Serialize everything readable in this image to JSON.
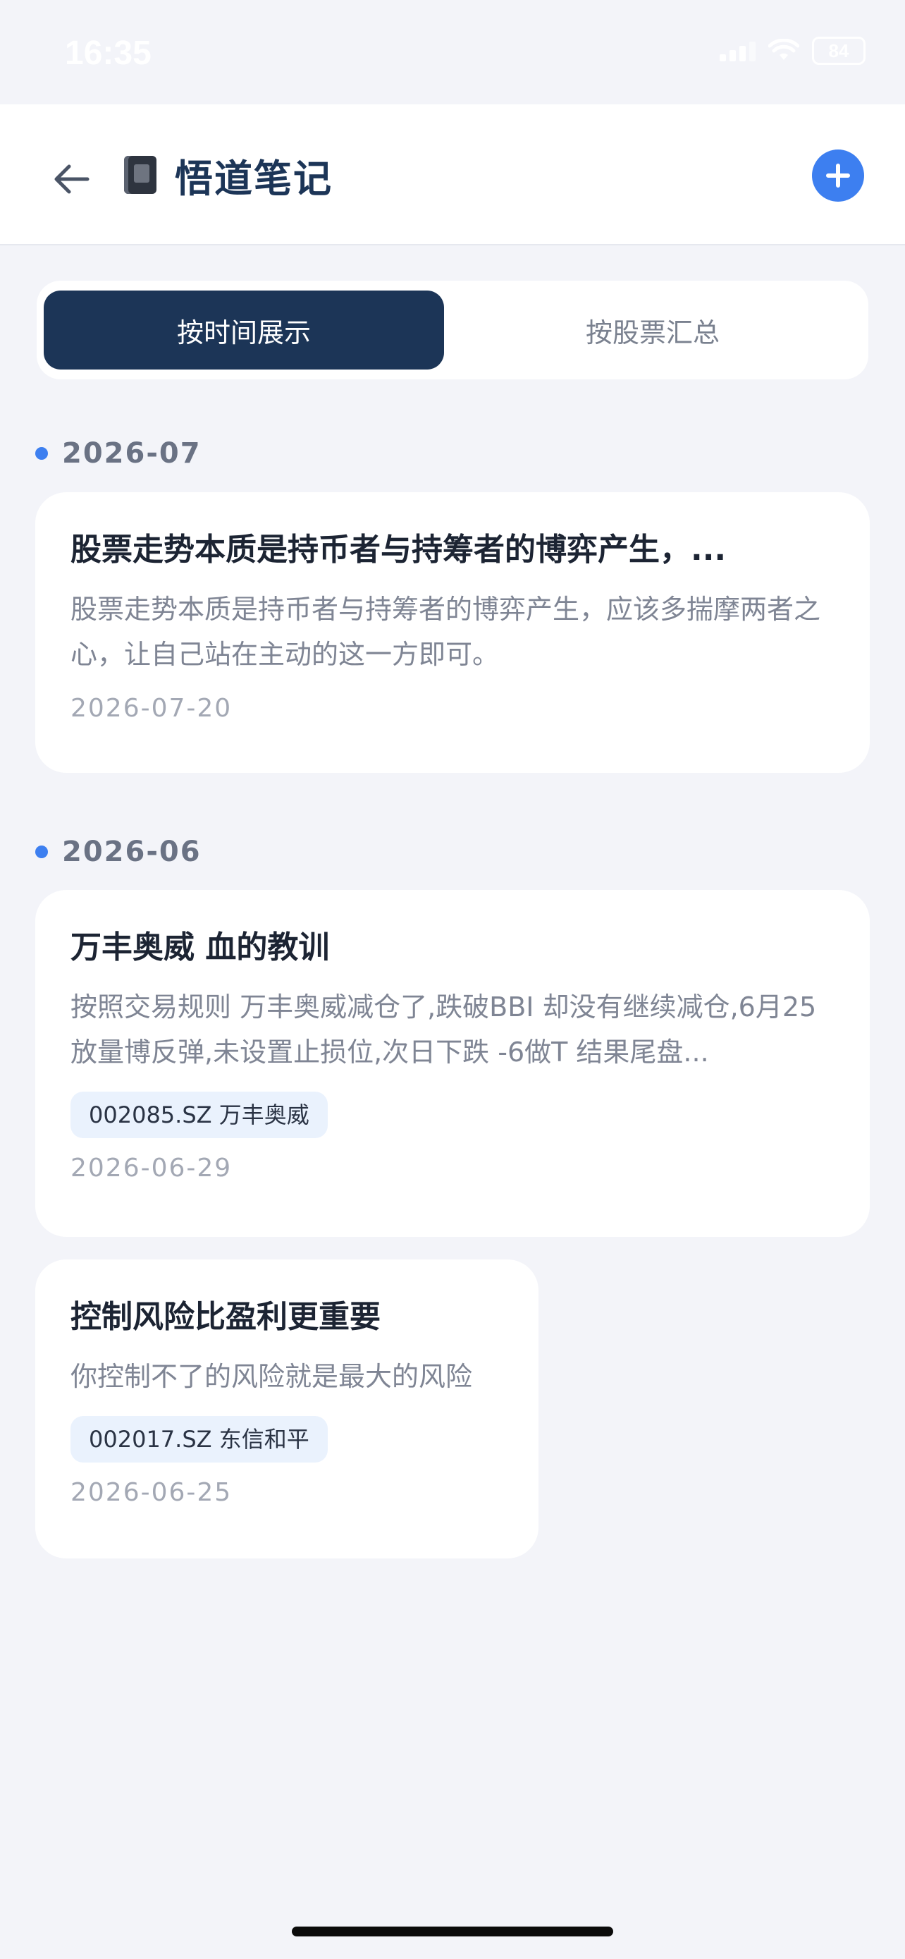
{
  "status_bar": {
    "time": "16:35",
    "battery": "84"
  },
  "header": {
    "title": "悟道笔记"
  },
  "segment": {
    "tabs": [
      "按时间展示",
      "按股票汇总"
    ],
    "active_index": 0
  },
  "groups": [
    {
      "month": "2026-07",
      "notes": [
        {
          "title": "股票走势本质是持币者与持筹者的博弈产生，...",
          "body": "股票走势本质是持币者与持筹者的博弈产生，应该多揣摩两者之心，让自己站在主动的这一方即可。",
          "tag": "",
          "date": "2026-07-20"
        }
      ]
    },
    {
      "month": "2026-06",
      "notes": [
        {
          "title": "万丰奥威 血的教训",
          "body": "按照交易规则 万丰奥威减仓了,跌破BBI 却没有继续减仓,6月25放量博反弹,未设置止损位,次日下跌 -6做T 结果尾盘...",
          "tag": "002085.SZ 万丰奥威",
          "date": "2026-06-29"
        },
        {
          "title": "控制风险比盈利更重要",
          "body": "你控制不了的风险就是最大的风险",
          "tag": "002017.SZ 东信和平",
          "date": "2026-06-25"
        }
      ]
    }
  ],
  "colors": {
    "accent": "#3d7ff0",
    "navy": "#1c3557",
    "background": "#f3f4f9"
  }
}
